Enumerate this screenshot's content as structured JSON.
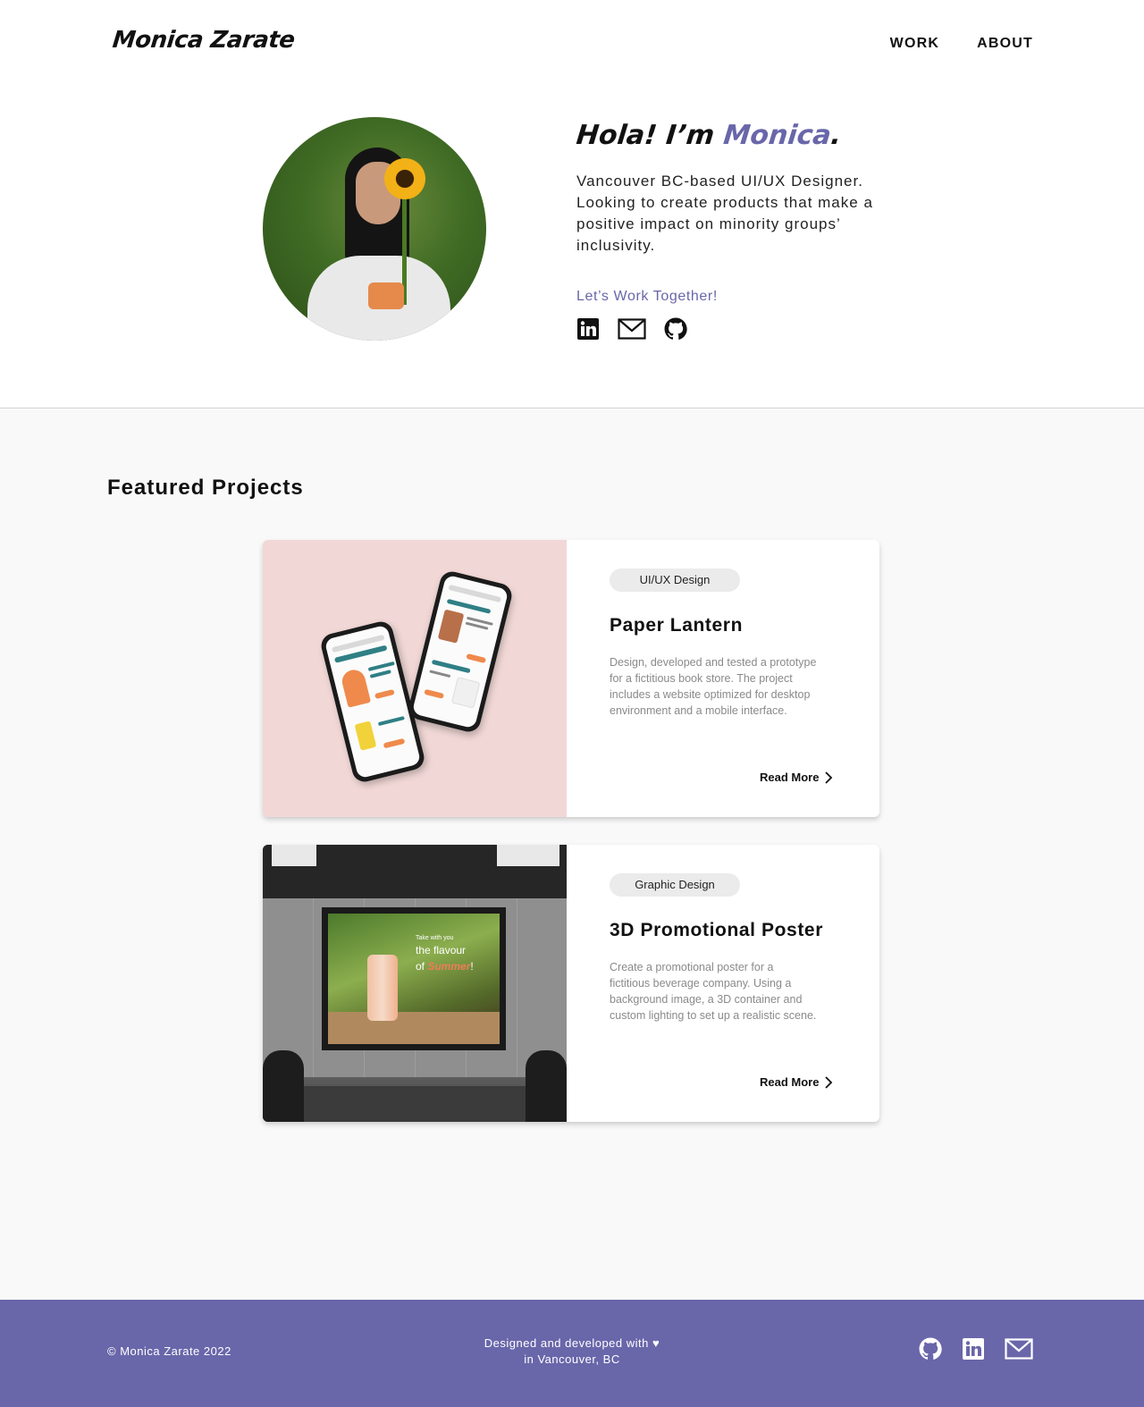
{
  "header": {
    "logo": "Monica Zarate",
    "nav": [
      "WORK",
      "ABOUT"
    ]
  },
  "hero": {
    "greeting_prefix": "Hola! I’m ",
    "greeting_name": "Monica",
    "greeting_suffix": ".",
    "bio": "Vancouver BC-based UI/UX Designer. Looking to create products that make a positive impact on minority groups’ inclusivity.",
    "cta": "Let’s Work Together!",
    "socials": [
      "linkedin-icon",
      "mail-icon",
      "github-icon"
    ]
  },
  "projects": {
    "title": "Featured Projects",
    "items": [
      {
        "tag": "UI/UX Design",
        "title": "Paper Lantern",
        "description": "Design, developed and tested a prototype for a fictitious book store. The project includes a website optimized for desktop environment and a mobile interface.",
        "link": "Read More"
      },
      {
        "tag": "Graphic Design",
        "title": "3D Promotional Poster",
        "description": "Create a promotional poster for a fictitious beverage company. Using a background image, a 3D container and custom lighting to set up a realistic scene.",
        "link": "Read More"
      }
    ]
  },
  "footer": {
    "copyright": "© Monica Zarate 2022",
    "credit_line1": "Designed and developed with ♥",
    "credit_line2": "in Vancouver, BC",
    "socials": [
      "github-icon",
      "linkedin-icon",
      "mail-icon"
    ]
  },
  "colors": {
    "accent": "#6966aa",
    "footer_bg": "#6966aa",
    "section_bg": "#f9f9f9",
    "card_thumb_pink": "#f1d8d6"
  }
}
